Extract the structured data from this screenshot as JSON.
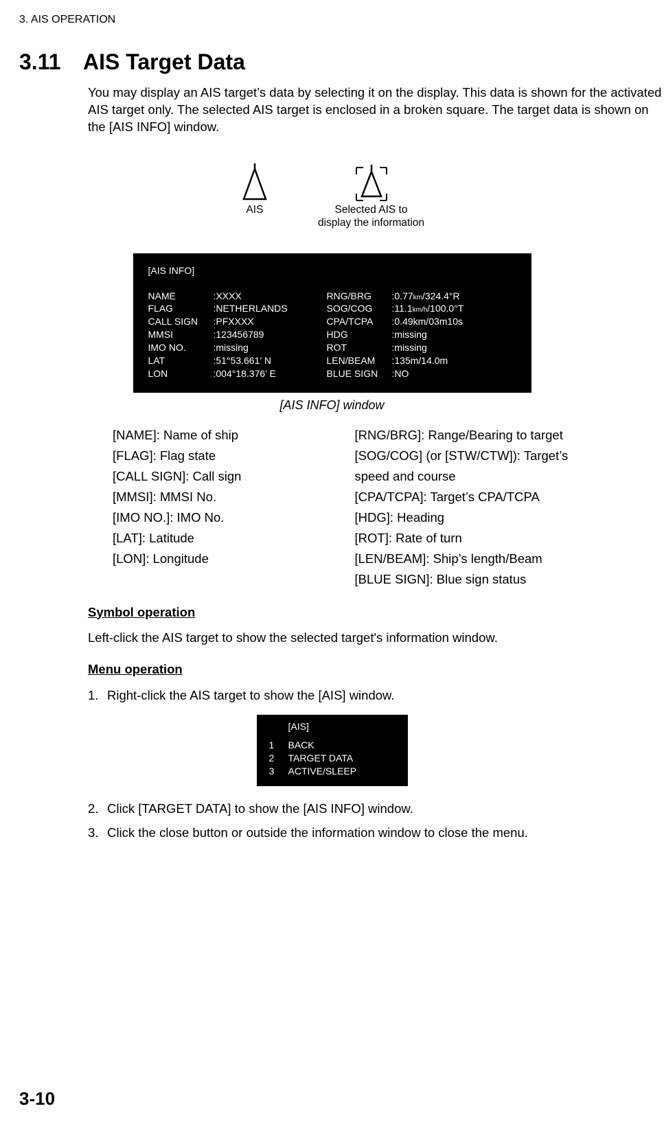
{
  "header": {
    "chapter": "3.  AIS OPERATION"
  },
  "section": {
    "num": "3.11",
    "title": "AIS Target Data"
  },
  "intro": "You may display an AIS target’s data by selecting it on the display. This data is shown for the activated AIS target only. The selected AIS target is enclosed in a broken square. The target data is shown on the [AIS INFO] window.",
  "symbols": {
    "ais": "AIS",
    "selected_line1": "Selected AIS to",
    "selected_line2": "display the information"
  },
  "ais_info": {
    "title": "[AIS INFO]",
    "left_labels": [
      "NAME",
      "FLAG",
      "CALL SIGN",
      "MMSI",
      "IMO NO.",
      "LAT",
      "LON"
    ],
    "left_values": [
      ":XXXX",
      ":NETHERLANDS",
      ":PFXXXX",
      ":123456789",
      ":missing",
      ":51°53.661’ N",
      ":004°18.376’ E"
    ],
    "right_labels": [
      "RNG/BRG",
      "SOG/COG",
      "CPA/TCPA",
      "HDG",
      "ROT",
      "LEN/BEAM",
      "BLUE SIGN"
    ],
    "right_values": {
      "rng_pre": ":0.77",
      "rng_unit": "km",
      "rng_post": "/324.4°R",
      "sog_pre": ":11.1",
      "sog_unit": "km/h",
      "sog_post": "/100.0°T",
      "cpa": ":0.49km/03m10s",
      "hdg": ":missing",
      "rot": ":missing",
      "len": ":135m/14.0m",
      "blue": ":NO"
    }
  },
  "window_caption": "[AIS INFO] window",
  "defs_left": [
    "[NAME]: Name of ship",
    "[FLAG]: Flag state",
    "[CALL SIGN]: Call sign",
    "[MMSI]: MMSI No.",
    "[IMO NO.]: IMO No.",
    "[LAT]: Latitude",
    "[LON]: Longitude"
  ],
  "defs_right": [
    "[RNG/BRG]: Range/Bearing to target",
    "[SOG/COG] (or [STW/CTW]): Target’s speed and course",
    "[CPA/TCPA]: Target’s CPA/TCPA",
    "[HDG]: Heading",
    "[ROT]: Rate of turn",
    "[LEN/BEAM]: Ship’s length/Beam",
    "[BLUE SIGN]: Blue sign status"
  ],
  "symbol_op_heading": "Symbol operation",
  "symbol_op_text": "Left-click the AIS target to show the selected target's information window.",
  "menu_op_heading": "Menu operation",
  "steps": {
    "s1": "Right-click the AIS target to show the [AIS] window.",
    "s2": "Click [TARGET DATA] to show the [AIS INFO] window.",
    "s3": "Click the close button or outside the information window to close the menu."
  },
  "ais_menu": {
    "title": "[AIS]",
    "items": [
      {
        "n": "1",
        "label": "BACK"
      },
      {
        "n": "2",
        "label": "TARGET DATA"
      },
      {
        "n": "3",
        "label": "ACTIVE/SLEEP"
      }
    ]
  },
  "page_number": "3-10"
}
